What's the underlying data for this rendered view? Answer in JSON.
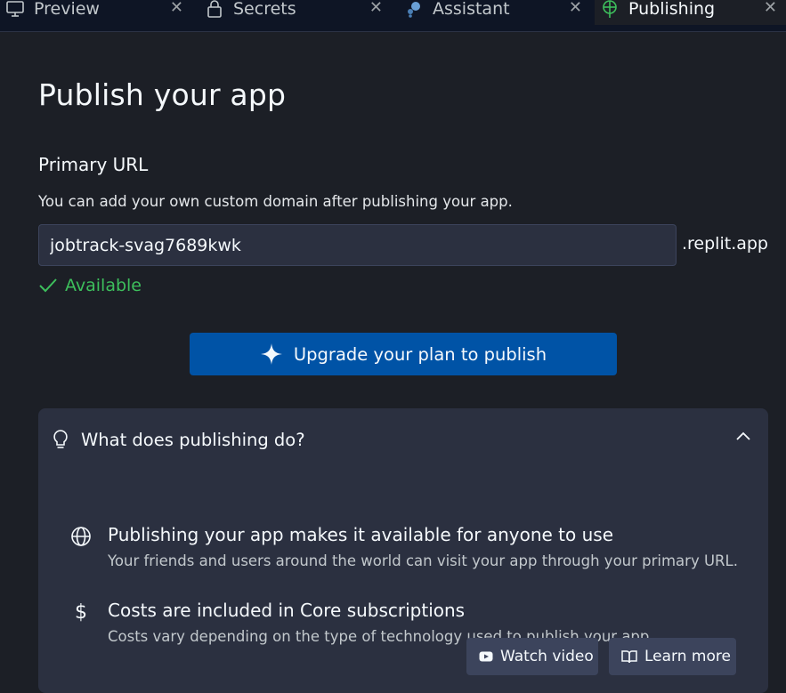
{
  "tabs": [
    {
      "label": "Preview",
      "icon": "monitor-icon"
    },
    {
      "label": "Secrets",
      "icon": "lock-icon"
    },
    {
      "label": "Assistant",
      "icon": "assistant-icon"
    },
    {
      "label": "Publishing",
      "icon": "publishing-icon",
      "active": true
    }
  ],
  "main": {
    "title": "Publish your app",
    "url_section": {
      "label": "Primary URL",
      "help": "You can add your own custom domain after publishing your app.",
      "input_value": "jobtrack-svag7689kwk",
      "suffix": ".replit.app",
      "status": "Available"
    },
    "upgrade_button": "Upgrade your plan to publish"
  },
  "panel": {
    "title": "What does publishing do?",
    "items": [
      {
        "icon": "globe-icon",
        "title": "Publishing your app makes it available for anyone to use",
        "description": "Your friends and users around the world can visit your app through your primary URL."
      },
      {
        "icon": "dollar-icon",
        "title": "Costs are included in Core subscriptions",
        "description": "Costs vary depending on the type of technology used to publish your app."
      }
    ],
    "watch_video": "Watch video",
    "learn_more": "Learn more"
  },
  "colors": {
    "background": "#1c1f26",
    "tabbar": "#0e1525",
    "panel": "#2b3040",
    "primary_button": "#0053a6",
    "available_green": "#3dbf5c"
  }
}
